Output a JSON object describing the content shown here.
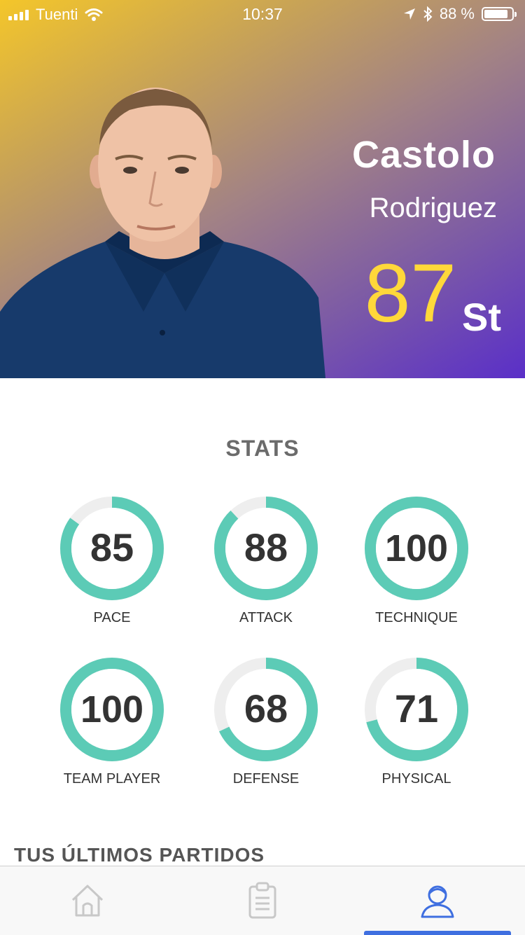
{
  "status_bar": {
    "carrier": "Tuenti",
    "time": "10:37",
    "battery": "88 %"
  },
  "player": {
    "first_name": "Castolo",
    "last_name": "Rodriguez",
    "rating": "87",
    "position": "St"
  },
  "stats": {
    "title": "STATS",
    "items": [
      {
        "label": "PACE",
        "value": "85"
      },
      {
        "label": "ATTACK",
        "value": "88"
      },
      {
        "label": "TECHNIQUE",
        "value": "100"
      },
      {
        "label": "TEAM PLAYER",
        "value": "100"
      },
      {
        "label": "DEFENSE",
        "value": "68"
      },
      {
        "label": "PHYSICAL",
        "value": "71"
      }
    ]
  },
  "recent_matches": {
    "title": "TUS ÚLTIMOS PARTIDOS"
  },
  "tabbar": {
    "tabs": [
      {
        "icon": "home-icon",
        "active": false
      },
      {
        "icon": "clipboard-icon",
        "active": false
      },
      {
        "icon": "profile-icon",
        "active": true
      }
    ],
    "active_color": "#3f6fe0"
  },
  "colors": {
    "accent": "#5ccbb6",
    "rating": "#ffd83a"
  }
}
